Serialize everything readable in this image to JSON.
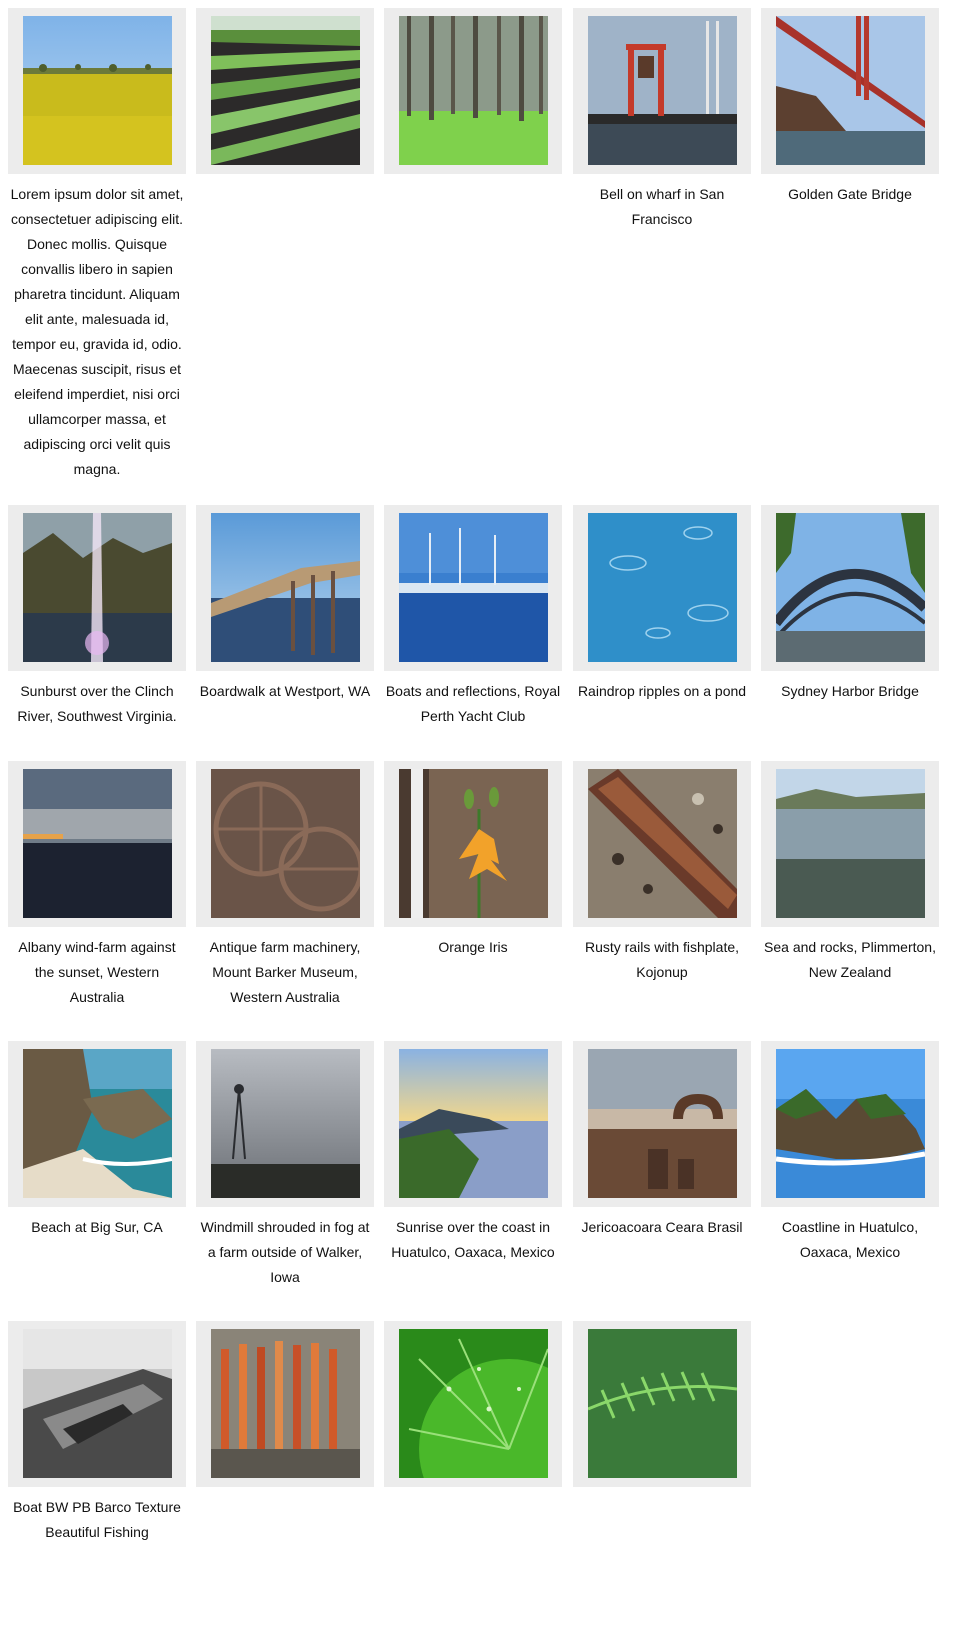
{
  "gallery": {
    "items": [
      {
        "caption": "Lorem ipsum dolor sit amet, consectetuer adipiscing elit. Donec mollis. Quisque convallis libero in sapien pharetra tincidunt. Aliquam elit ante, malesuada id, tempor eu, gravida id, odio. Maecenas suscipit, risus et eleifend imperdiet, nisi orci ullamcorper massa, et adipiscing orci velit quis magna.",
        "scene": "canola-field"
      },
      {
        "caption": "",
        "scene": "crop-rows"
      },
      {
        "caption": "",
        "scene": "pine-forest"
      },
      {
        "caption": "Bell on wharf in San Francisco",
        "scene": "wharf-bell"
      },
      {
        "caption": "Golden Gate Bridge",
        "scene": "golden-gate"
      },
      {
        "caption": "Sunburst over the Clinch River, Southwest Virginia.",
        "scene": "sunburst-river"
      },
      {
        "caption": "Boardwalk at Westport, WA",
        "scene": "boardwalk"
      },
      {
        "caption": "Boats and reflections, Royal Perth Yacht Club",
        "scene": "marina"
      },
      {
        "caption": "Raindrop ripples on a pond",
        "scene": "ripples"
      },
      {
        "caption": "Sydney Harbor Bridge",
        "scene": "harbour-bridge"
      },
      {
        "caption": "Albany wind-farm against the sunset, Western Australia",
        "scene": "dusk-coast"
      },
      {
        "caption": "Antique farm machinery, Mount Barker Museum, Western Australia",
        "scene": "machinery"
      },
      {
        "caption": "Orange Iris",
        "scene": "orange-lily"
      },
      {
        "caption": "Rusty rails with fishplate, Kojonup",
        "scene": "rusty-rail"
      },
      {
        "caption": "Sea and rocks, Plimmerton, New Zealand",
        "scene": "sea-rocks"
      },
      {
        "caption": "Beach at Big Sur, CA",
        "scene": "big-sur"
      },
      {
        "caption": "Windmill shrouded in fog at a farm outside of Walker, Iowa",
        "scene": "fog-windmill"
      },
      {
        "caption": "Sunrise over the coast in Huatulco, Oaxaca, Mexico",
        "scene": "sunrise-coast"
      },
      {
        "caption": "Jericoacoara Ceara Brasil",
        "scene": "rock-arch"
      },
      {
        "caption": "Coastline in Huatulco, Oaxaca, Mexico",
        "scene": "coastline-rocks"
      },
      {
        "caption": "Boat BW PB Barco Texture Beautiful Fishing",
        "scene": "bw-boat"
      },
      {
        "caption": "",
        "scene": "embers"
      },
      {
        "caption": "",
        "scene": "green-leaf"
      },
      {
        "caption": "",
        "scene": "fern"
      }
    ]
  }
}
